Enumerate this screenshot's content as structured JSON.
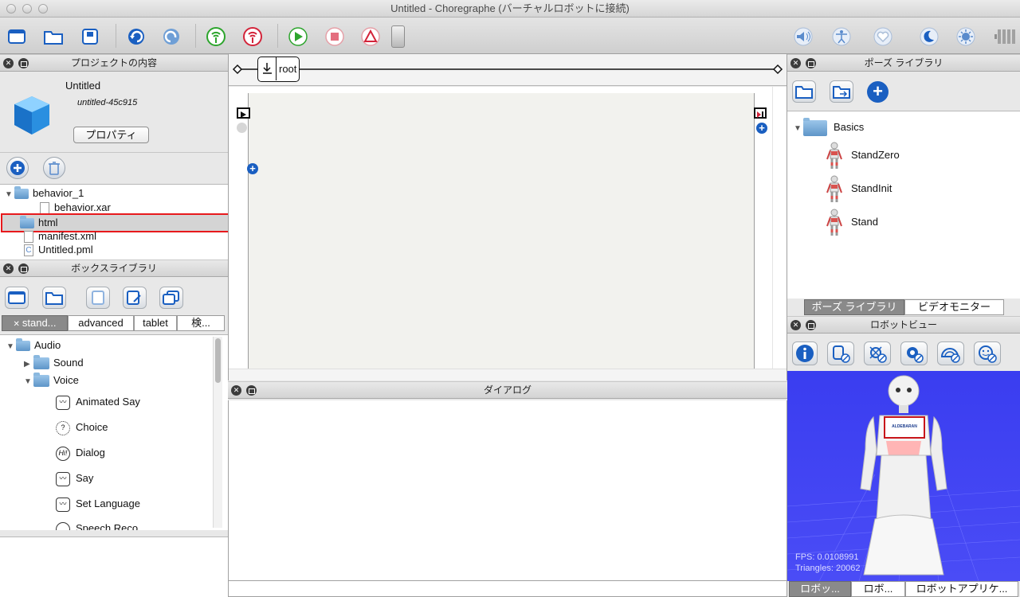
{
  "window": {
    "title": "Untitled - Choregraphe (バーチャルロボットに接続)"
  },
  "project_panel": {
    "header": "プロジェクトの内容",
    "project_name": "Untitled",
    "project_id": "untitled-45c915",
    "properties_button": "プロパティ",
    "tree": [
      {
        "label": "behavior_1",
        "kind": "folder",
        "expanded": true
      },
      {
        "label": "behavior.xar",
        "kind": "file"
      },
      {
        "label": "html",
        "kind": "folder",
        "selected": true
      },
      {
        "label": "manifest.xml",
        "kind": "file"
      },
      {
        "label": "Untitled.pml",
        "kind": "pml"
      }
    ]
  },
  "box_library": {
    "header": "ボックスライブラリ",
    "tabs": [
      "stand...",
      "advanced",
      "tablet",
      "検..."
    ],
    "tree": [
      {
        "label": "Audio",
        "kind": "folder"
      },
      {
        "label": "Sound",
        "kind": "folder"
      },
      {
        "label": "Voice",
        "kind": "folder"
      },
      {
        "label": "Animated Say",
        "kind": "box"
      },
      {
        "label": "Choice",
        "kind": "box"
      },
      {
        "label": "Dialog",
        "kind": "box"
      },
      {
        "label": "Say",
        "kind": "box"
      },
      {
        "label": "Set Language",
        "kind": "box"
      },
      {
        "label": "Speech Reco.",
        "kind": "box"
      }
    ]
  },
  "flow": {
    "breadcrumb": "root"
  },
  "dialog_panel": {
    "header": "ダイアログ"
  },
  "pose_library": {
    "header": "ポーズ ライブラリ",
    "folder": "Basics",
    "items": [
      "StandZero",
      "StandInit",
      "Stand"
    ],
    "tabs": [
      "ポーズ ライブラリ",
      "ビデオモニター"
    ]
  },
  "robot_view": {
    "header": "ロボットビュー",
    "fps": "FPS: 0.0108991",
    "triangles": "Triangles: 20062",
    "chest_logo": "ALDEBARAN",
    "tabs": [
      "ロボッ...",
      "ロボ...",
      "ロボットアプリケ..."
    ]
  },
  "colors": {
    "highlight": "#e8191c",
    "accent_blue": "#1a5fc1",
    "robot_bg": "#3a3df0"
  }
}
